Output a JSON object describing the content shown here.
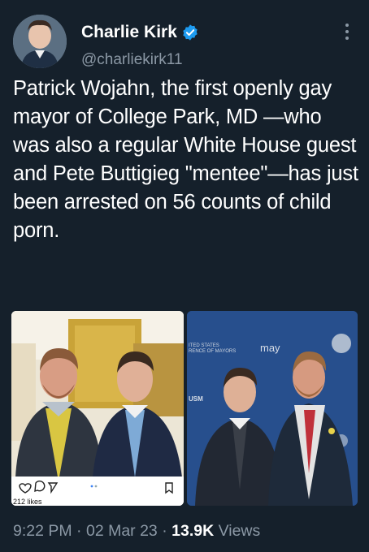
{
  "author": {
    "display_name": "Charlie Kirk",
    "handle": "@charliekirk11",
    "verified_icon": "verified-badge-icon",
    "avatar_icon": "avatar"
  },
  "tweet": {
    "text": "Patrick Wojahn, the first openly gay mayor of College Park, MD —who was also a regular White House guest and Pete Buttigieg \"mentee\"—has just been arrested on 56 counts of child porn."
  },
  "media": {
    "left_photo": {
      "likes_text": "212 likes"
    },
    "right_photo": {
      "banner_text_1": "ITED STATES",
      "banner_text_2": "RENCE OF MAYORS",
      "banner_text_3": "may",
      "banner_text_4": "USM"
    }
  },
  "meta": {
    "time": "9:22 PM",
    "date": "02 Mar 23",
    "views_count": "13.9K",
    "views_label": "Views",
    "separator": "·"
  },
  "colors": {
    "background": "#15202b",
    "text_primary": "#ffffff",
    "text_secondary": "#8b98a5",
    "verified": "#1d9bf0"
  }
}
